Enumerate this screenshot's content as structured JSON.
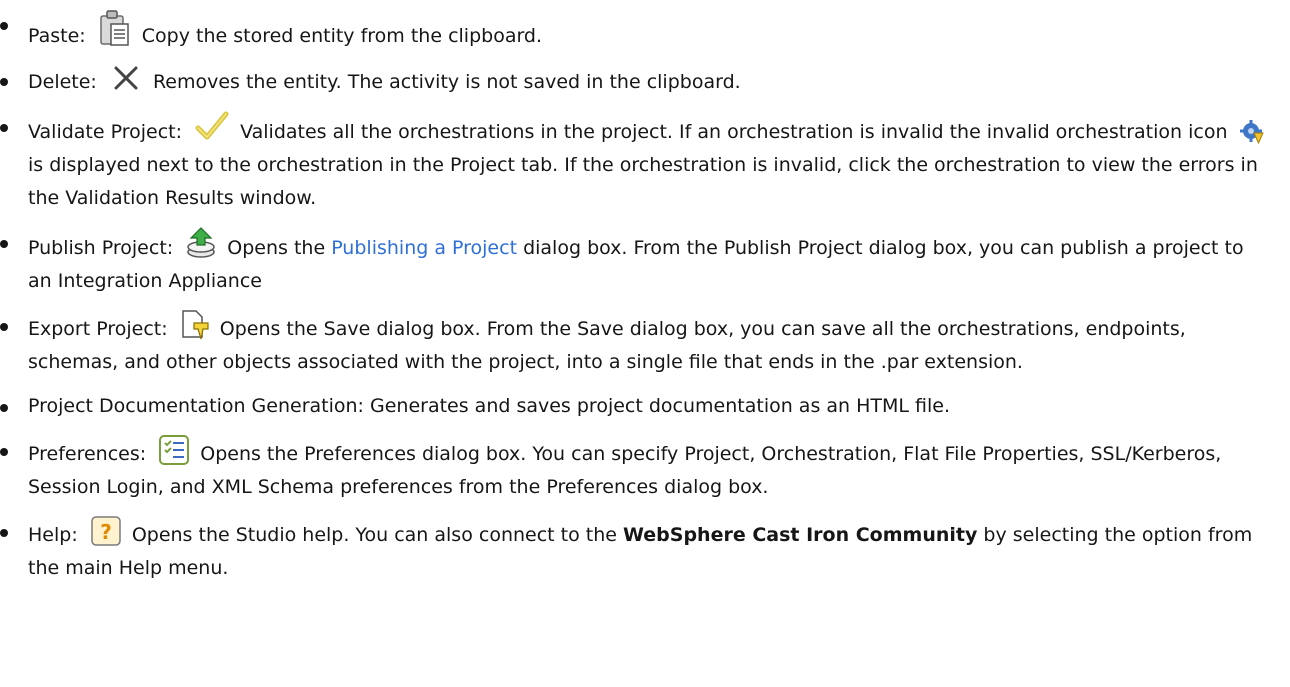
{
  "items": [
    {
      "label": "Paste:",
      "icon": "paste-icon",
      "text": "Copy the stored entity from the clipboard."
    },
    {
      "label": "Delete:",
      "icon": "delete-x-icon",
      "text": "Removes the entity. The activity is not saved in the clipboard."
    },
    {
      "label": "Validate Project:",
      "icon": "checkmark-icon",
      "text_a": "Validates all the orchestrations in the project. If an orchestration is invalid the invalid orchestration icon",
      "inline_icon": "invalid-orchestration-icon",
      "text_b": "is displayed next to the orchestration in the Project tab. If the orchestration is invalid, click the orchestration to view the errors in the Validation Results window."
    },
    {
      "label": "Publish Project:",
      "icon": "publish-icon",
      "text_a": "Opens the",
      "link": "Publishing a Project",
      "text_b": "dialog box. From the Publish Project dialog box, you can publish a project to an Integration Appliance"
    },
    {
      "label": "Export Project:",
      "icon": "export-icon",
      "text": "Opens the Save dialog box. From the Save dialog box, you can save all the orchestrations, endpoints, schemas, and other objects associated with the project, into a single file that ends in the .par extension."
    },
    {
      "label": "Project Documentation Generation:",
      "text": "Generates and saves project documentation as an HTML file."
    },
    {
      "label": "Preferences:",
      "icon": "preferences-icon",
      "text": "Opens the Preferences dialog box. You can specify Project, Orchestration, Flat File Properties, SSL/Kerberos, Session Login, and XML Schema preferences from the Preferences dialog box."
    },
    {
      "label": "Help:",
      "icon": "help-icon",
      "text_a": "Opens the Studio help. You can also connect to the",
      "strong": "WebSphere Cast Iron Community",
      "text_b": "by selecting the option from the main Help menu."
    }
  ]
}
